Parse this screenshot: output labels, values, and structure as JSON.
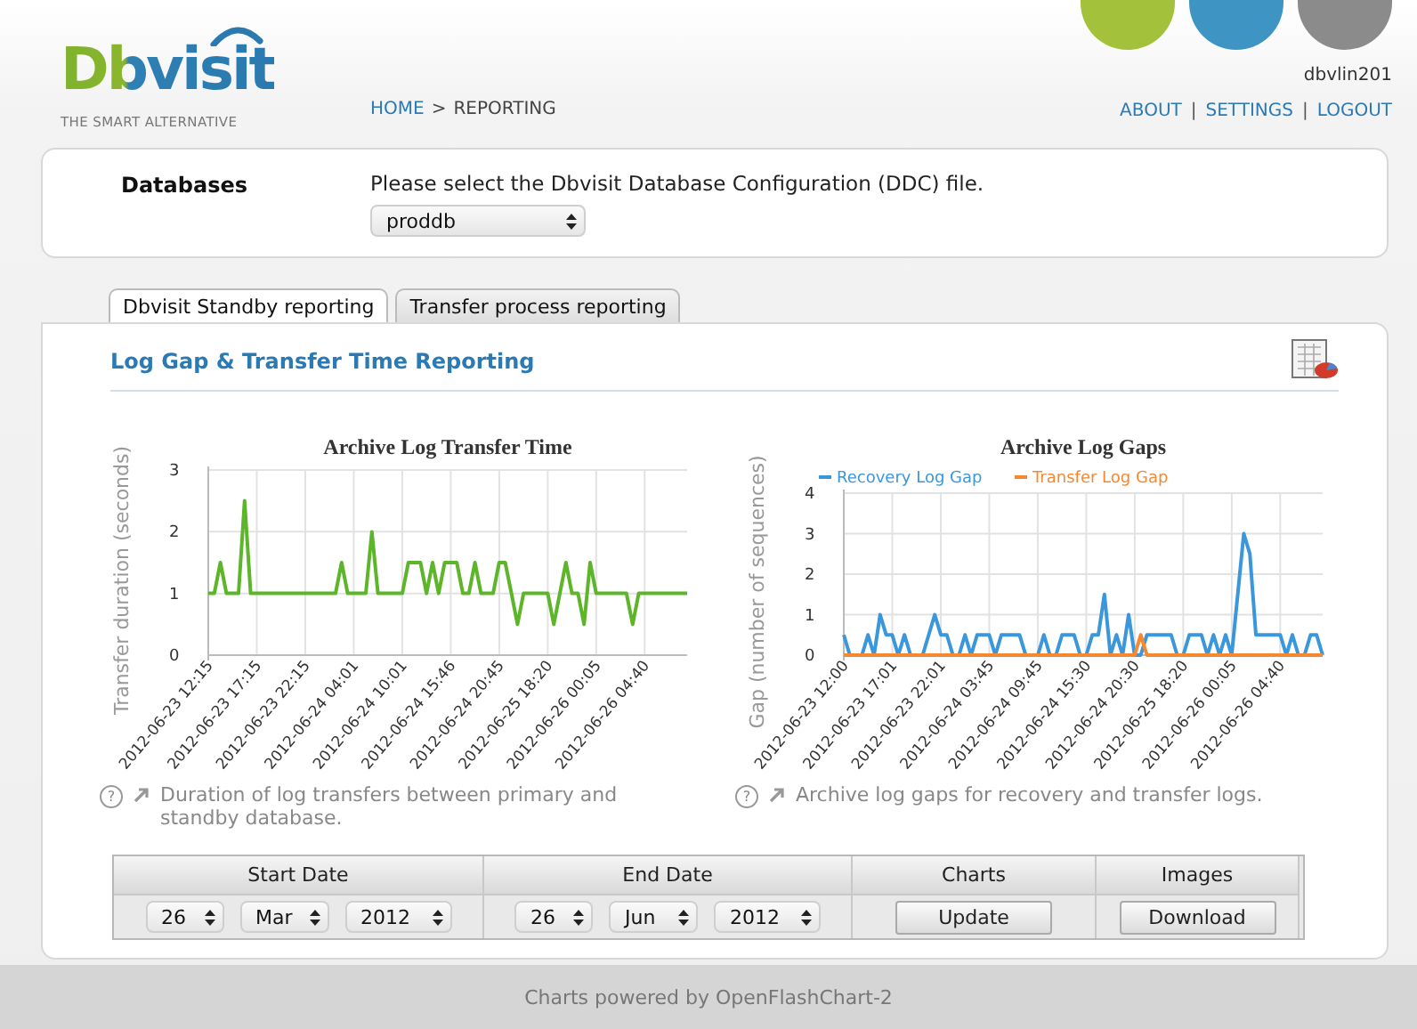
{
  "header": {
    "logo": {
      "name": "Dbvisit",
      "tagline": "THE SMART ALTERNATIVE"
    },
    "breadcrumb": [
      {
        "label": "HOME",
        "link": true
      },
      {
        "label": "REPORTING",
        "link": false
      }
    ],
    "breadcrumb_separator": ">",
    "user": "dbvlin201",
    "nav": [
      "ABOUT",
      "SETTINGS",
      "LOGOUT"
    ],
    "nav_separator": "|"
  },
  "databases": {
    "label": "Databases",
    "prompt": "Please select the Dbvisit Database Configuration (DDC) file.",
    "select": "proddb"
  },
  "tabs": [
    {
      "label": "Dbvisit Standby reporting",
      "selected": true
    },
    {
      "label": "Transfer process reporting",
      "selected": false
    }
  ],
  "section_title": "Log Gap & Transfer Time Reporting",
  "charts": [
    {
      "help": "?",
      "caption": "Duration of log transfers between primary and standby database.",
      "chart_data": {
        "type": "line",
        "title": "Archive Log Transfer Time",
        "ylabel": "Transfer duration (seconds)",
        "ylim": [
          0,
          3
        ],
        "yticks": [
          0,
          1,
          2,
          3
        ],
        "grid": true,
        "categories": [
          "2012-06-23 12:15",
          null,
          null,
          null,
          null,
          null,
          null,
          null,
          "2012-06-23 17:15",
          null,
          null,
          null,
          null,
          null,
          null,
          null,
          "2012-06-23 22:15",
          null,
          null,
          null,
          null,
          null,
          null,
          null,
          "2012-06-24 04:01",
          null,
          null,
          null,
          null,
          null,
          null,
          null,
          "2012-06-24 10:01",
          null,
          null,
          null,
          null,
          null,
          null,
          null,
          "2012-06-24 15:46",
          null,
          null,
          null,
          null,
          null,
          null,
          null,
          "2012-06-24 20:45",
          null,
          null,
          null,
          null,
          null,
          null,
          null,
          "2012-06-25 18:20",
          null,
          null,
          null,
          null,
          null,
          null,
          null,
          "2012-06-26 00:05",
          null,
          null,
          null,
          null,
          null,
          null,
          null,
          "2012-06-26 04:40",
          null,
          null,
          null,
          null,
          null,
          null,
          null
        ],
        "series": [
          {
            "color": "#5db52a",
            "values": [
              1,
              1,
              1.5,
              1,
              1,
              1,
              2.5,
              1,
              1,
              1,
              1,
              1,
              1,
              1,
              1,
              1,
              1,
              1,
              1,
              1,
              1,
              1,
              1.5,
              1,
              1,
              1,
              1,
              2,
              1,
              1,
              1,
              1,
              1,
              1.5,
              1.5,
              1.5,
              1,
              1.5,
              1,
              1.5,
              1.5,
              1.5,
              1,
              1,
              1.5,
              1,
              1,
              1,
              1.5,
              1.5,
              1,
              0.5,
              1,
              1,
              1,
              1,
              1,
              0.5,
              1,
              1.5,
              1,
              1,
              0.5,
              1.5,
              1,
              1,
              1,
              1,
              1,
              1,
              0.5,
              1,
              1,
              1,
              1,
              1,
              1,
              1,
              1,
              1
            ]
          }
        ]
      }
    },
    {
      "help": "?",
      "caption": "Archive log gaps for recovery and transfer logs.",
      "chart_data": {
        "type": "line",
        "title": "Archive Log Gaps",
        "ylabel": "Gap (number of sequences)",
        "ylim": [
          0,
          4
        ],
        "yticks": [
          0,
          1,
          2,
          3,
          4
        ],
        "grid": true,
        "legend": "top",
        "categories": [
          "2012-06-23 12:00",
          null,
          null,
          null,
          null,
          null,
          null,
          null,
          "2012-06-23 17:01",
          null,
          null,
          null,
          null,
          null,
          null,
          null,
          "2012-06-23 22:01",
          null,
          null,
          null,
          null,
          null,
          null,
          null,
          "2012-06-24 03:45",
          null,
          null,
          null,
          null,
          null,
          null,
          null,
          "2012-06-24 09:45",
          null,
          null,
          null,
          null,
          null,
          null,
          null,
          "2012-06-24 15:30",
          null,
          null,
          null,
          null,
          null,
          null,
          null,
          "2012-06-24 20:30",
          null,
          null,
          null,
          null,
          null,
          null,
          null,
          "2012-06-25 18:20",
          null,
          null,
          null,
          null,
          null,
          null,
          null,
          "2012-06-26 00:05",
          null,
          null,
          null,
          null,
          null,
          null,
          null,
          "2012-06-26 04:40",
          null,
          null,
          null,
          null,
          null,
          null,
          null
        ],
        "series": [
          {
            "name": "Recovery Log Gap",
            "color": "#3a97db",
            "values": [
              0.5,
              0,
              0,
              0,
              0.5,
              0,
              1,
              0.5,
              0.5,
              0,
              0.5,
              0,
              0,
              0,
              0.5,
              1,
              0.5,
              0.5,
              0,
              0,
              0.5,
              0,
              0.5,
              0.5,
              0.5,
              0,
              0.5,
              0.5,
              0.5,
              0.5,
              0,
              0,
              0,
              0.5,
              0,
              0,
              0.5,
              0.5,
              0.5,
              0,
              0,
              0.5,
              0.5,
              1.5,
              0,
              0.5,
              0,
              1,
              0,
              0,
              0.5,
              0.5,
              0.5,
              0.5,
              0.5,
              0,
              0,
              0.5,
              0.5,
              0.5,
              0,
              0.5,
              0,
              0.5,
              0,
              1.5,
              3,
              2.5,
              0.5,
              0.5,
              0.5,
              0.5,
              0.5,
              0,
              0.5,
              0,
              0,
              0.5,
              0.5,
              0
            ]
          },
          {
            "name": "Transfer Log Gap",
            "color": "#f7882f",
            "values": [
              0,
              0,
              0,
              0,
              0,
              0,
              0,
              0,
              0,
              0,
              0,
              0,
              0,
              0,
              0,
              0,
              0,
              0,
              0,
              0,
              0,
              0,
              0,
              0,
              0,
              0,
              0,
              0,
              0,
              0,
              0,
              0,
              0,
              0,
              0,
              0,
              0,
              0,
              0,
              0,
              0,
              0,
              0,
              0,
              0,
              0,
              0,
              0,
              0,
              0.5,
              0,
              0,
              0,
              0,
              0,
              0,
              0,
              0,
              0,
              0,
              0,
              0,
              0,
              0,
              0,
              0,
              0,
              0,
              0,
              0,
              0,
              0,
              0,
              0,
              0,
              0,
              0,
              0,
              0,
              0
            ]
          }
        ]
      }
    }
  ],
  "filters": {
    "columns": [
      "Start Date",
      "End Date",
      "Charts",
      "Images"
    ],
    "start": {
      "day": "26",
      "month": "Mar",
      "year": "2012"
    },
    "end": {
      "day": "26",
      "month": "Jun",
      "year": "2012"
    },
    "update_button": "Update",
    "download_button": "Download"
  },
  "footer": "Charts powered by OpenFlashChart-2"
}
